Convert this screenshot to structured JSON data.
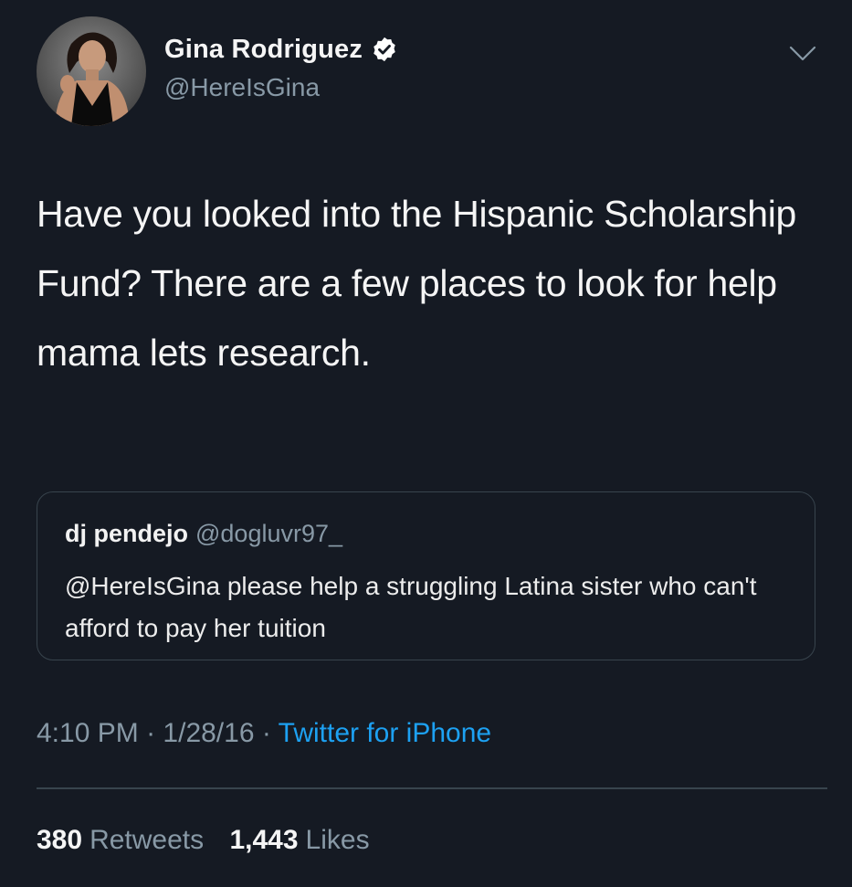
{
  "tweet": {
    "author": {
      "display_name": "Gina Rodriguez",
      "handle": "@HereIsGina",
      "verified": true,
      "verified_color": "#ffffff"
    },
    "text": "Have you looked into the Hispanic Scholarship Fund? There are a few places to look for help mama lets research.",
    "quoted": {
      "display_name": "dj pendejo",
      "handle": "@dogluvr97_",
      "text": "@HereIsGina please help a struggling Latina sister who can't afford to pay her tuition"
    },
    "meta": {
      "time": "4:10 PM",
      "date": "1/28/16",
      "separator": "·",
      "source": "Twitter for iPhone",
      "source_color": "#1da1f2"
    },
    "stats": {
      "retweets_count": "380",
      "retweets_label": "Retweets",
      "likes_count": "1,443",
      "likes_label": "Likes"
    }
  },
  "icons": {
    "menu": "chevron-down-icon",
    "verified": "verified-badge-icon"
  },
  "colors": {
    "background": "#151a23",
    "text_primary": "#f5f5f5",
    "text_secondary": "#8899a6",
    "border": "#38444d"
  }
}
